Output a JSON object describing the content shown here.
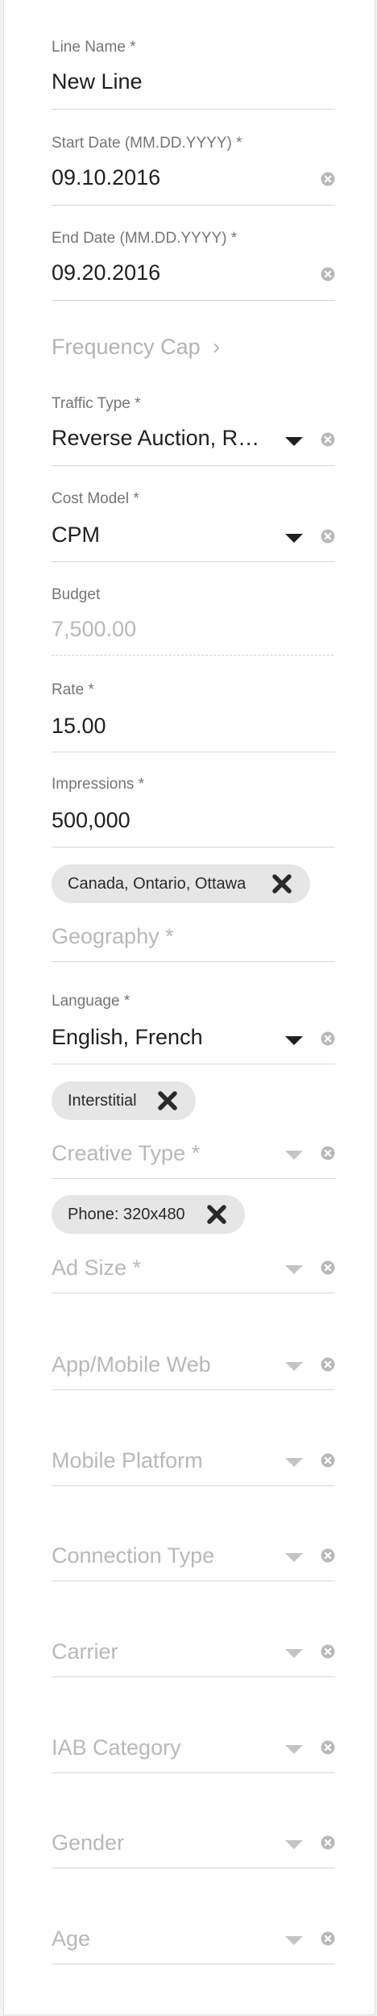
{
  "form": {
    "line_name": {
      "label": "Line Name *",
      "value": "New Line"
    },
    "start_date": {
      "label": "Start Date (MM.DD.YYYY) *",
      "value": "09.10.2016"
    },
    "end_date": {
      "label": "End Date (MM.DD.YYYY) *",
      "value": "09.20.2016"
    },
    "frequency_cap": {
      "label": "Frequency Cap",
      "chevron": "›"
    },
    "traffic_type": {
      "label": "Traffic Type *",
      "value": "Reverse Auction, Real Time Bidding"
    },
    "cost_model": {
      "label": "Cost Model *",
      "value": "CPM"
    },
    "budget": {
      "label": "Budget",
      "value": "7,500.00"
    },
    "rate": {
      "label": "Rate *",
      "value": "15.00"
    },
    "impressions": {
      "label": "Impressions *",
      "value": "500,000"
    },
    "geography": {
      "chip": "Canada, Ontario, Ottawa",
      "placeholder": "Geography *"
    },
    "language": {
      "label": "Language *",
      "value": "English, French"
    },
    "creative_type": {
      "chip": "Interstitial",
      "placeholder": "Creative Type *"
    },
    "ad_size": {
      "chip": "Phone: 320x480",
      "placeholder": "Ad Size *"
    },
    "app_mobile_web": {
      "placeholder": "App/Mobile Web"
    },
    "mobile_platform": {
      "placeholder": "Mobile Platform"
    },
    "connection_type": {
      "placeholder": "Connection Type"
    },
    "carrier": {
      "placeholder": "Carrier"
    },
    "iab_category": {
      "placeholder": "IAB Category"
    },
    "gender": {
      "placeholder": "Gender"
    },
    "age": {
      "placeholder": "Age"
    }
  },
  "icons": {
    "clear": "clear-circle-icon",
    "dropdown": "triangle-down-icon",
    "remove_chip": "x-icon"
  },
  "colors": {
    "text": "#1f1f1f",
    "label": "#757575",
    "placeholder": "#b8b8b8",
    "chip": "#e6e6e6"
  }
}
